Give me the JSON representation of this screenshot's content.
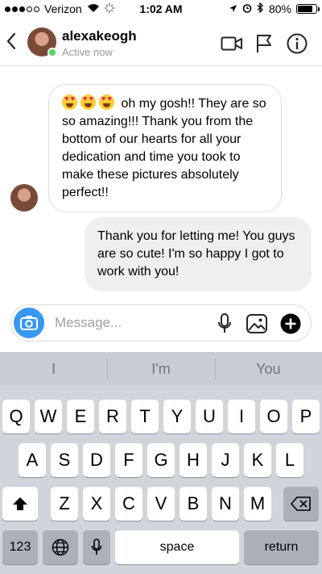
{
  "status_bar": {
    "carrier": "Verizon",
    "time": "1:02 AM",
    "battery_text": "80%",
    "battery_level": 0.8
  },
  "header": {
    "username": "alexakeogh",
    "status": "Active now"
  },
  "messages": [
    {
      "direction": "incoming",
      "emoji_count": 3,
      "emoji": "heart-eyes-emoji",
      "text": "oh my gosh!! They are so so amazing!!! Thank you from the bottom of our hearts for all your dedication and time you took to make these pictures absolutely perfect!!"
    },
    {
      "direction": "outgoing",
      "text": "Thank you for letting me! You guys are so cute! I'm so happy I got to work with you!"
    }
  ],
  "composer": {
    "placeholder": "Message..."
  },
  "keyboard": {
    "suggestions": [
      "I",
      "I'm",
      "You"
    ],
    "row1": [
      "Q",
      "W",
      "E",
      "R",
      "T",
      "Y",
      "U",
      "I",
      "O",
      "P"
    ],
    "row2": [
      "A",
      "S",
      "D",
      "F",
      "G",
      "H",
      "J",
      "K",
      "L"
    ],
    "row3": [
      "Z",
      "X",
      "C",
      "V",
      "B",
      "N",
      "M"
    ],
    "numbers_label": "123",
    "space_label": "space",
    "return_label": "return"
  },
  "colors": {
    "accent": "#3897f0",
    "online": "#4cd964",
    "outgoing_bubble": "#efefef",
    "keyboard_bg": "#d1d4da"
  }
}
